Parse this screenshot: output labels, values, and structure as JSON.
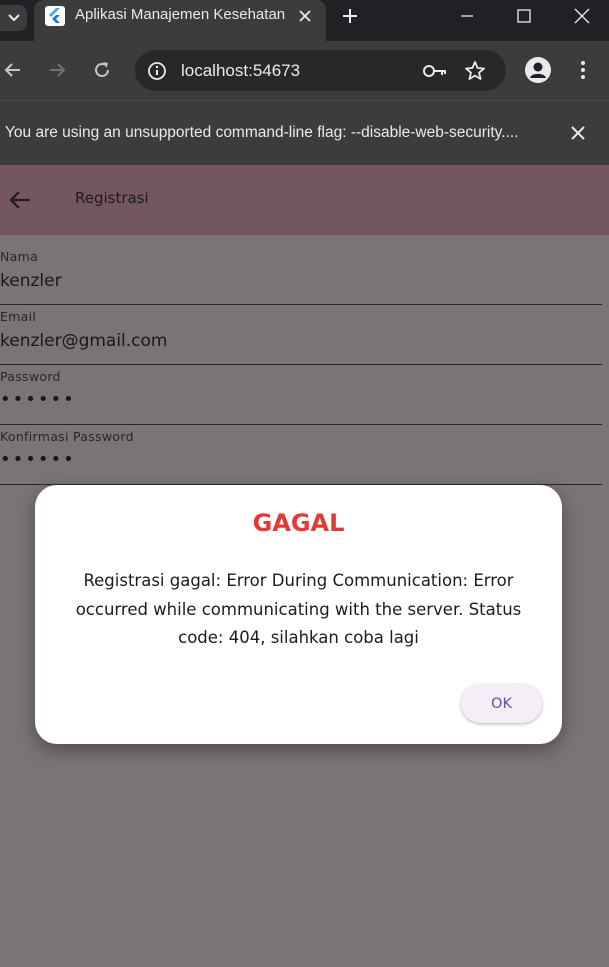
{
  "browser": {
    "tab": {
      "title": "Aplikasi Manajemen Kesehatan",
      "favicon": "flutter-icon"
    },
    "address": "localhost:54673",
    "infobar": {
      "message": "You are using an unsupported command-line flag: --disable-web-security...."
    }
  },
  "app": {
    "appbar": {
      "title": "Registrasi"
    },
    "fields": [
      {
        "label": "Nama",
        "value": "kenzler"
      },
      {
        "label": "Email",
        "value": "kenzler@gmail.com"
      },
      {
        "label": "Password",
        "value": "••••••"
      },
      {
        "label": "Konfirmasi Password",
        "value": "••••••"
      }
    ]
  },
  "dialog": {
    "title": "GAGAL",
    "message": "Registrasi gagal: Error During Communication: Error occurred while communicating with the server. Status code: 404, silahkan coba lagi",
    "ok_label": "OK"
  },
  "colors": {
    "appbar": "#735660",
    "scrim_background": "#7a7378",
    "error_title": "#e53935",
    "ok_text": "#6750a4"
  }
}
